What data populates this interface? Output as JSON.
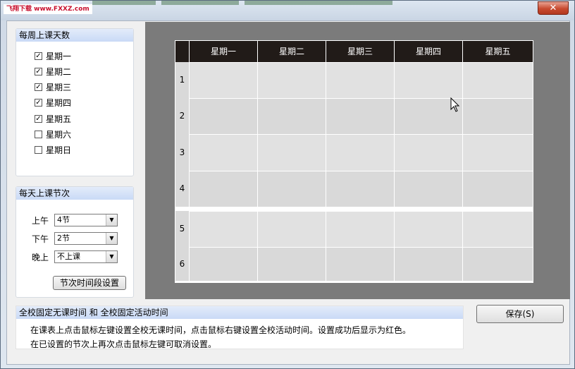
{
  "window": {
    "watermark": "飞翔下载 www.FXXZ.com",
    "close_label": "✕"
  },
  "days_panel": {
    "title": "每周上课天数",
    "days": [
      {
        "label": "星期一",
        "checked": true
      },
      {
        "label": "星期二",
        "checked": true
      },
      {
        "label": "星期三",
        "checked": true
      },
      {
        "label": "星期四",
        "checked": true
      },
      {
        "label": "星期五",
        "checked": true
      },
      {
        "label": "星期六",
        "checked": false
      },
      {
        "label": "星期日",
        "checked": false
      }
    ]
  },
  "periods_panel": {
    "title": "每天上课节次",
    "rows": [
      {
        "label": "上午",
        "value": "4节"
      },
      {
        "label": "下午",
        "value": "2节"
      },
      {
        "label": "晚上",
        "value": "不上课"
      }
    ],
    "time_button": "节次时间段设置"
  },
  "timetable": {
    "columns": [
      "星期一",
      "星期二",
      "星期三",
      "星期四",
      "星期五"
    ],
    "rows": [
      "1",
      "2",
      "3",
      "4",
      "5",
      "6"
    ]
  },
  "info": {
    "title": "全校固定无课时间 和 全校固定活动时间",
    "line1": "在课表上点击鼠标左键设置全校无课时间，点击鼠标右键设置全校活动时间。设置成功后显示为红色。",
    "line2": "在已设置的节次上再次点击鼠标左键可取消设置。"
  },
  "save_button": "保存(S)"
}
